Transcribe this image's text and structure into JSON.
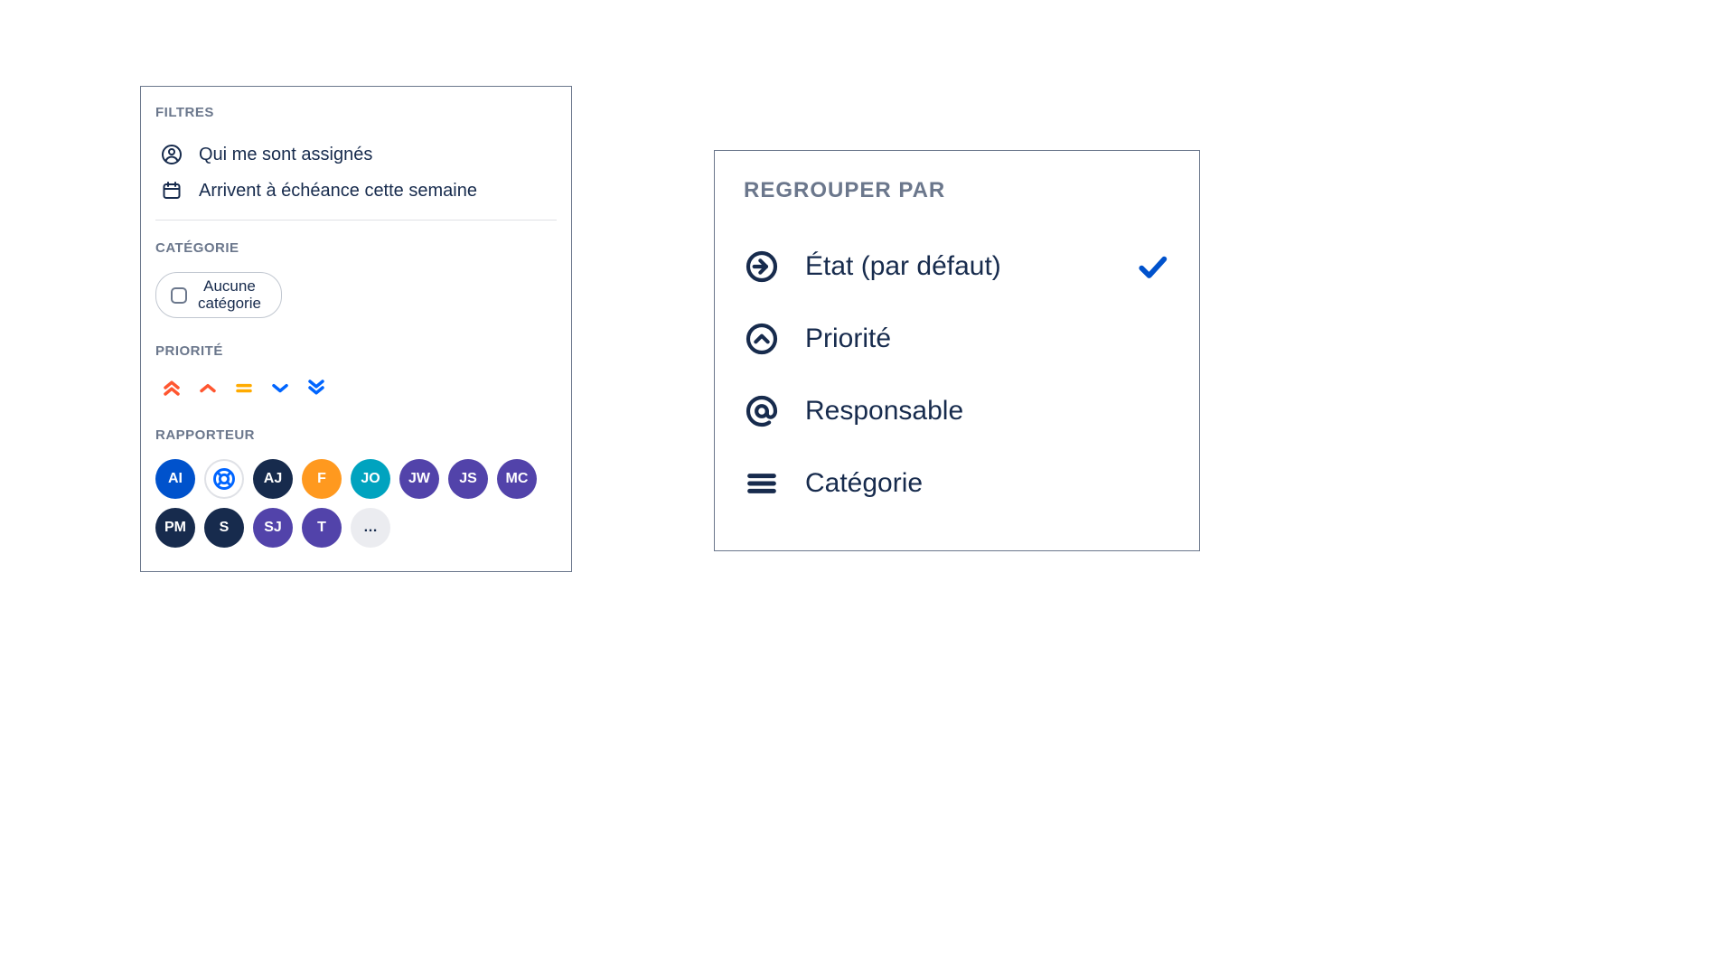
{
  "filters": {
    "heading": "FILTRES",
    "items": [
      {
        "label": "Qui me sont assignés"
      },
      {
        "label": "Arrivent à échéance cette semaine"
      }
    ],
    "category": {
      "heading": "CATÉGORIE",
      "chip_label": "Aucune\ncatégorie"
    },
    "priority": {
      "heading": "PRIORITÉ",
      "levels": [
        "highest",
        "high",
        "medium",
        "low",
        "lowest"
      ]
    },
    "reporter": {
      "heading": "RAPPORTEUR",
      "avatars": [
        {
          "initials": "AI",
          "bg": "#0052CC"
        },
        {
          "initials": "",
          "bg": "#FFFFFF",
          "icon": "lifebuoy"
        },
        {
          "initials": "AJ",
          "bg": "#172B4D"
        },
        {
          "initials": "F",
          "bg": "#FF991F"
        },
        {
          "initials": "JO",
          "bg": "#00A3BF"
        },
        {
          "initials": "JW",
          "bg": "#5243AA"
        },
        {
          "initials": "JS",
          "bg": "#5243AA"
        },
        {
          "initials": "MC",
          "bg": "#5243AA"
        },
        {
          "initials": "PM",
          "bg": "#172B4D"
        },
        {
          "initials": "S",
          "bg": "#172B4D"
        },
        {
          "initials": "SJ",
          "bg": "#5243AA"
        },
        {
          "initials": "T",
          "bg": "#5243AA"
        },
        {
          "initials": "…",
          "bg": "#EBECF0",
          "fg": "#172B4D"
        }
      ]
    }
  },
  "group": {
    "heading": "REGROUPER PAR",
    "items": [
      {
        "label": "État (par défaut)",
        "icon": "status",
        "selected": true
      },
      {
        "label": "Priorité",
        "icon": "priority",
        "selected": false
      },
      {
        "label": "Responsable",
        "icon": "assignee",
        "selected": false
      },
      {
        "label": "Catégorie",
        "icon": "category",
        "selected": false
      }
    ]
  }
}
